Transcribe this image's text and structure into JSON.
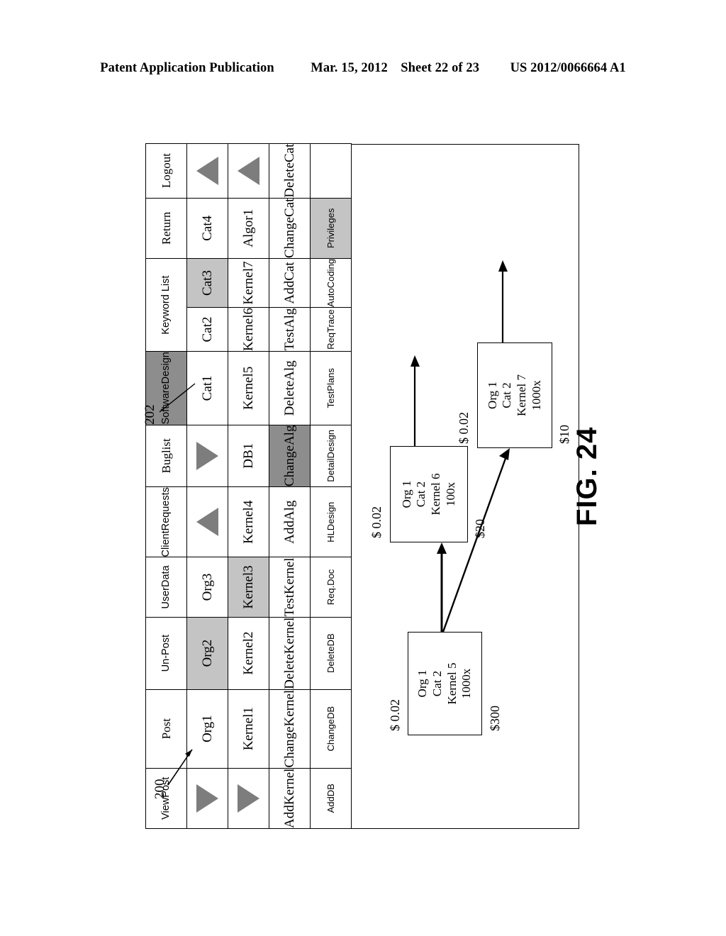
{
  "header": {
    "publication": "Patent Application Publication",
    "date": "Mar. 15, 2012",
    "sheet": "Sheet 22 of 23",
    "number": "US 2012/0066664 A1"
  },
  "figure": {
    "label": "FIG. 24",
    "callouts": [
      {
        "id": "200",
        "text": "200"
      },
      {
        "id": "202",
        "text": "202"
      }
    ]
  },
  "menu_grid": {
    "columns": [
      {
        "header": "View Post",
        "header_lines": [
          "View",
          "Post"
        ],
        "cells": [
          {
            "type": "triangle-down",
            "label": "triangle-down-icon"
          },
          {
            "type": "triangle-down",
            "label": "triangle-down-icon"
          },
          {
            "type": "text",
            "lines": [
              "Add",
              "Kernel"
            ]
          },
          {
            "type": "text",
            "lines": [
              "Add",
              "DB"
            ]
          }
        ]
      },
      {
        "header": "Post",
        "header_lines": [
          "Post"
        ],
        "cells": [
          {
            "type": "text",
            "lines": [
              "Org",
              "1"
            ]
          },
          {
            "type": "text",
            "lines": [
              "Kernel",
              "1"
            ]
          },
          {
            "type": "text",
            "lines": [
              "Change",
              "Kernel"
            ]
          },
          {
            "type": "text",
            "lines": [
              "Change",
              "DB"
            ]
          }
        ]
      },
      {
        "header": "Un- Post",
        "header_lines": [
          "Un-",
          "Post"
        ],
        "cells": [
          {
            "type": "text",
            "lines": [
              "Org",
              "2"
            ],
            "shade": "light"
          },
          {
            "type": "text",
            "lines": [
              "Kernel",
              "2"
            ]
          },
          {
            "type": "text",
            "lines": [
              "Delete",
              "Kernel"
            ]
          },
          {
            "type": "text",
            "lines": [
              "Delete",
              "DB"
            ]
          }
        ]
      },
      {
        "header": "User Data",
        "header_lines": [
          "User",
          "Data"
        ],
        "cells": [
          {
            "type": "text",
            "lines": [
              "Org",
              "3"
            ]
          },
          {
            "type": "text",
            "lines": [
              "Kernel",
              "3"
            ],
            "shade": "light"
          },
          {
            "type": "text",
            "lines": [
              "Test",
              "Kernel"
            ]
          },
          {
            "type": "text",
            "lines": [
              "Req.",
              "Doc"
            ]
          }
        ]
      },
      {
        "header": "Client Requests",
        "header_lines": [
          "Client",
          "Requests"
        ],
        "cells": [
          {
            "type": "triangle-up",
            "label": "triangle-up-icon"
          },
          {
            "type": "text",
            "lines": [
              "Kernel",
              "4"
            ]
          },
          {
            "type": "text",
            "lines": [
              "Add",
              "Alg"
            ]
          },
          {
            "type": "text",
            "lines": [
              "HL",
              "Design"
            ]
          }
        ]
      },
      {
        "header": "Buglist",
        "header_lines": [
          "Buglist"
        ],
        "cells": [
          {
            "type": "triangle-down",
            "label": "triangle-down-icon"
          },
          {
            "type": "text",
            "lines": [
              "DB",
              "1"
            ]
          },
          {
            "type": "text",
            "lines": [
              "Change",
              "Alg"
            ],
            "shade": "dark"
          },
          {
            "type": "text",
            "lines": [
              "Detail",
              "Design"
            ]
          }
        ]
      },
      {
        "header": "Software Design",
        "header_lines": [
          "Software",
          "Design"
        ],
        "header_shade": "dark",
        "cells": [
          {
            "type": "text",
            "lines": [
              "Cat",
              "1"
            ]
          },
          {
            "type": "text",
            "lines": [
              "Kernel",
              "5"
            ]
          },
          {
            "type": "text",
            "lines": [
              "Delete",
              "Alg"
            ]
          },
          {
            "type": "text",
            "lines": [
              "Test",
              "Plans"
            ]
          }
        ]
      },
      {
        "header": "Keyword List",
        "header_lines": [
          "Keyword List"
        ],
        "header_span": 2,
        "cells": [
          {
            "type": "text",
            "lines": [
              "Cat",
              "2"
            ]
          },
          {
            "type": "text",
            "lines": [
              "Kernel",
              "6"
            ]
          },
          {
            "type": "text",
            "lines": [
              "Test",
              "Alg"
            ]
          },
          {
            "type": "text",
            "lines": [
              "Req",
              "Trace"
            ]
          }
        ]
      },
      {
        "header": "",
        "header_lines": [],
        "header_merged": true,
        "cells": [
          {
            "type": "text",
            "lines": [
              "Cat",
              "3"
            ],
            "shade": "light"
          },
          {
            "type": "text",
            "lines": [
              "Kernel",
              "7"
            ]
          },
          {
            "type": "text",
            "lines": [
              "Add",
              "Cat"
            ]
          },
          {
            "type": "text",
            "lines": [
              "Auto",
              "Coding"
            ]
          }
        ]
      },
      {
        "header": "Return",
        "header_lines": [
          "Return"
        ],
        "cells": [
          {
            "type": "text",
            "lines": [
              "Cat",
              "4"
            ]
          },
          {
            "type": "text",
            "lines": [
              "Algor",
              "1"
            ]
          },
          {
            "type": "text",
            "lines": [
              "Change",
              "Cat"
            ]
          },
          {
            "type": "text",
            "lines": [
              "Privileges"
            ],
            "shade": "light"
          }
        ]
      },
      {
        "header": "Logout",
        "header_lines": [
          "Logout"
        ],
        "cells": [
          {
            "type": "triangle-up",
            "label": "triangle-up-icon"
          },
          {
            "type": "triangle-up",
            "label": "triangle-up-icon"
          },
          {
            "type": "text",
            "lines": [
              "Delete",
              "Cat"
            ]
          },
          {
            "type": "empty",
            "lines": []
          }
        ]
      }
    ]
  },
  "flow": {
    "nodes": [
      {
        "id": "kernel5",
        "lines": [
          "Org 1",
          "Cat 2",
          "Kernel 5",
          "1000x"
        ],
        "left_label": "$ 0.02",
        "right_label": "$300"
      },
      {
        "id": "kernel6",
        "lines": [
          "Org 1",
          "Cat 2",
          "Kernel 6",
          "100x"
        ],
        "left_label": "$ 0.02",
        "right_label": "$20"
      },
      {
        "id": "kernel7",
        "lines": [
          "Org 1",
          "Cat 2",
          "Kernel 7",
          "1000x"
        ],
        "left_label": "$ 0.02",
        "right_label": "$10"
      }
    ]
  }
}
